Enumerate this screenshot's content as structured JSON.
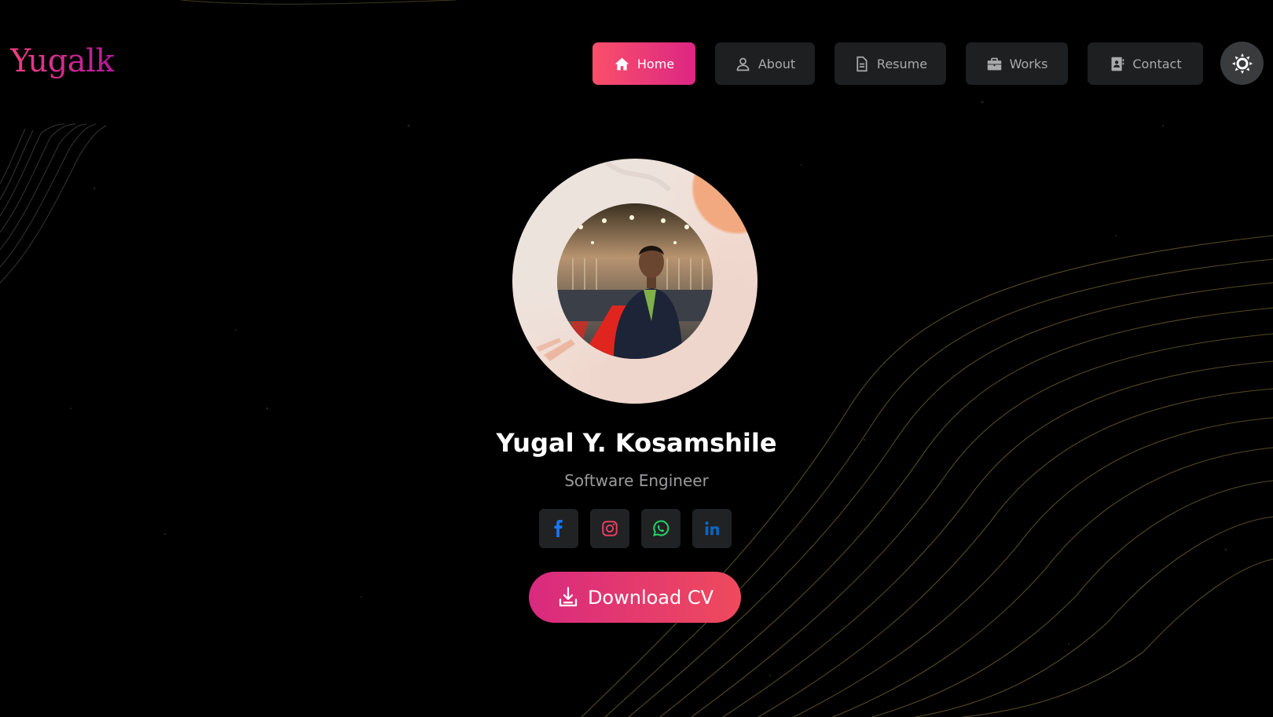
{
  "logo": "Yugalk",
  "nav": [
    {
      "label": "Home",
      "icon": "home-icon",
      "active": true
    },
    {
      "label": "About",
      "icon": "user-icon",
      "active": false
    },
    {
      "label": "Resume",
      "icon": "document-icon",
      "active": false
    },
    {
      "label": "Works",
      "icon": "briefcase-icon",
      "active": false
    },
    {
      "label": "Contact",
      "icon": "contact-card-icon",
      "active": false
    }
  ],
  "theme_toggle": {
    "icon": "sun-icon"
  },
  "profile": {
    "name": "Yugal Y. Kosamshile",
    "role": "Software Engineer"
  },
  "social": [
    {
      "icon": "facebook-icon",
      "color": "#1877f2"
    },
    {
      "icon": "instagram-icon",
      "color": "#e4405f"
    },
    {
      "icon": "whatsapp-icon",
      "color": "#25d366"
    },
    {
      "icon": "linkedin-icon",
      "color": "#0a66c2"
    }
  ],
  "cta": {
    "label": "Download CV",
    "icon": "download-icon"
  },
  "colors": {
    "accent_start": "#f9506a",
    "accent_end": "#dd2683",
    "background": "#000000",
    "nav_bg": "#1d1f21"
  }
}
